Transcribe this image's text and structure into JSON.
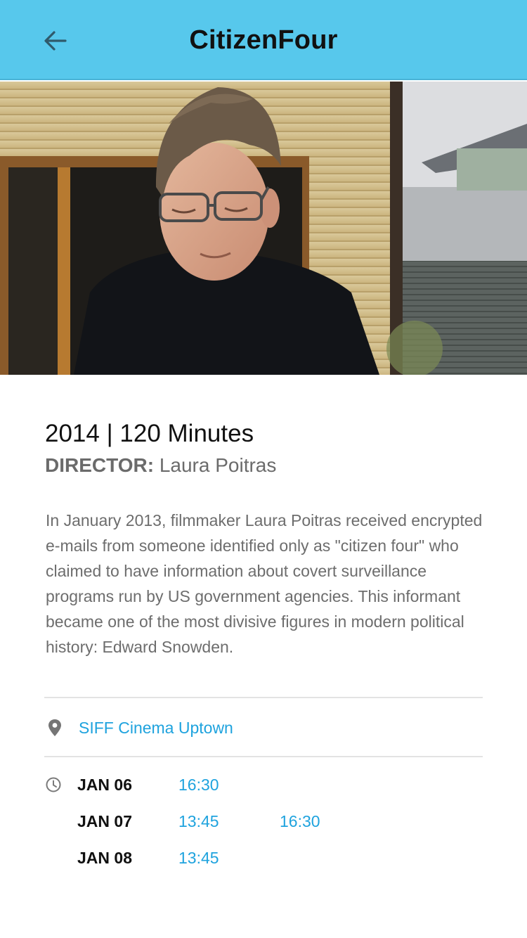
{
  "header": {
    "title": "CitizenFour",
    "back_icon": "arrow-back-icon",
    "background_color": "#57c8ec"
  },
  "hero": {
    "image": "still of a man in glasses and a black t-shirt looking down, outdoors near a house"
  },
  "film": {
    "year_runtime": "2014 | 120 Minutes",
    "director_label": "DIRECTOR:",
    "director_name": "Laura Poitras",
    "description": "In January 2013, filmmaker Laura Poitras received encrypted e-mails from someone identified only as \"citizen four\" who claimed to have information about covert surveillance programs run by US government agencies. This informant became one of the most divisive figures in modern political history: Edward Snowden."
  },
  "venue": {
    "icon": "location-pin-icon",
    "name": "SIFF Cinema Uptown"
  },
  "showtimes": {
    "icon": "clock-icon",
    "days": [
      {
        "date": "JAN 06",
        "times": [
          "16:30"
        ]
      },
      {
        "date": "JAN 07",
        "times": [
          "13:45",
          "16:30"
        ]
      },
      {
        "date": "JAN 08",
        "times": [
          "13:45"
        ]
      }
    ]
  },
  "colors": {
    "accent": "#1fa3de",
    "text_primary": "#111111",
    "text_secondary": "#6b6b6b"
  }
}
